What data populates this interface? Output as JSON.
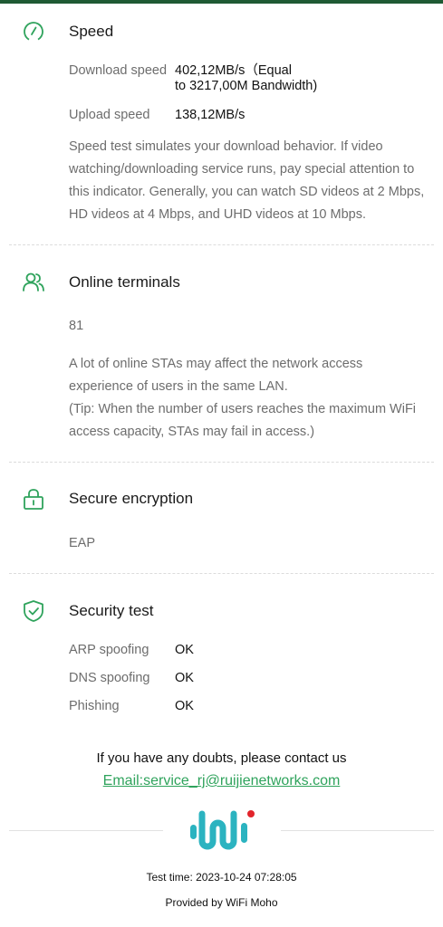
{
  "speed": {
    "title": "Speed",
    "download_label": "Download speed",
    "download_value_line1": "402,12MB/s（Equal",
    "download_value_line2": "to 3217,00M Bandwidth)",
    "upload_label": "Upload speed",
    "upload_value": "138,12MB/s",
    "description": "Speed test simulates your download behavior. If video watching/downloading service runs, pay special attention to this indicator. Generally, you can watch SD videos at 2 Mbps, HD videos at 4 Mbps, and UHD videos at 10 Mbps."
  },
  "terminals": {
    "title": "Online terminals",
    "count": "81",
    "description_line1": "A lot of online STAs may affect the network access experience of users in the same LAN.",
    "description_line2": "(Tip: When the number of users reaches the maximum WiFi access capacity, STAs may fail in access.)"
  },
  "encryption": {
    "title": "Secure encryption",
    "value": "EAP"
  },
  "security": {
    "title": "Security test",
    "items": [
      {
        "label": "ARP spoofing",
        "value": "OK"
      },
      {
        "label": "DNS spoofing",
        "value": "OK"
      },
      {
        "label": "Phishing",
        "value": "OK"
      }
    ]
  },
  "contact": {
    "text": "If you have any doubts, please contact us",
    "email": "Email:service_rj@ruijienetworks.com"
  },
  "footer": {
    "test_time": "Test time: 2023-10-24 07:28:05",
    "provided_by": "Provided by WiFi Moho"
  },
  "colors": {
    "accent": "#2fa35c",
    "logo_teal": "#2bb3c0",
    "logo_red": "#e2242b"
  }
}
